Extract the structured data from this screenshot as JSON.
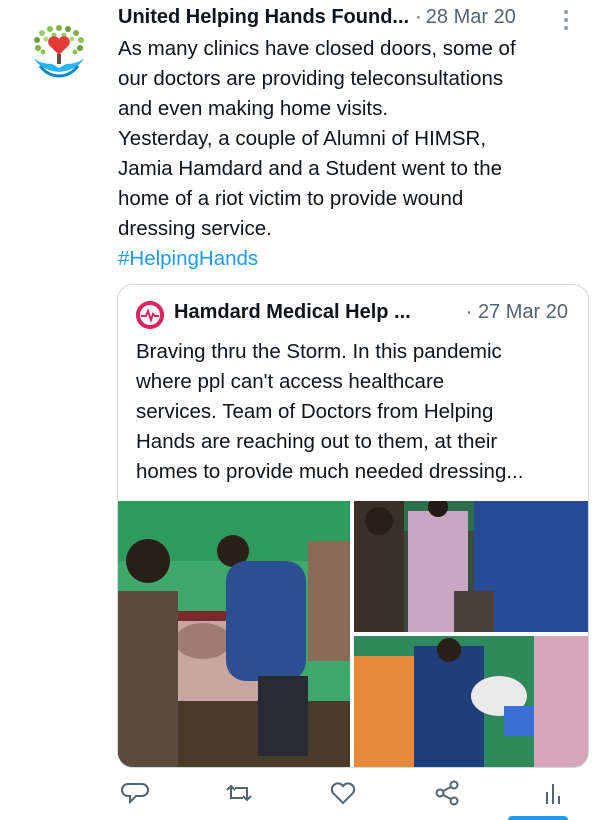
{
  "tweet": {
    "author": "United Helping Hands Found...",
    "separator": "·",
    "date": "28 Mar 20",
    "lines": [
      "As many clinics have closed doors, some of",
      "our doctors are providing teleconsultations",
      "and even making home visits.",
      "Yesterday, a couple of Alumni of HIMSR,",
      "Jamia Hamdard and a Student went to the",
      "home of a riot victim to provide wound",
      "dressing service."
    ],
    "hashtag": "#HelpingHands"
  },
  "quoted": {
    "author": "Hamdard Medical Help ...",
    "date": "· 27 Mar 20",
    "lines": [
      "Braving thru the Storm. In this pandemic",
      "where ppl can't access healthcare",
      "services. Team of Doctors from Helping",
      "Hands are reaching out to them, at their",
      "homes to provide much needed dressing..."
    ],
    "photos": [
      "photo-patient-treatment",
      "photo-doctors-standing",
      "photo-dressing-supplies"
    ]
  },
  "actions": {
    "icons": [
      "reply-icon",
      "retweet-icon",
      "like-icon",
      "share-icon",
      "analytics-icon"
    ]
  },
  "colors": {
    "accent": "#1d9bf0",
    "muted": "#536471",
    "border": "#cfd9de"
  }
}
